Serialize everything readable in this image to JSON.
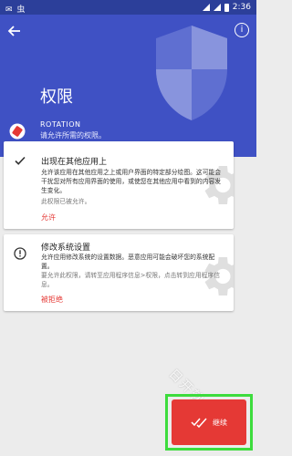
{
  "status_bar": {
    "left": "✉  虫",
    "time": "2:36"
  },
  "header": {
    "title": "权限",
    "app_name": "ROTATION",
    "app_subtitle": "请允许所需的权限。",
    "colors": {
      "bar": "#3f51c4",
      "status": "#2c3f9a"
    }
  },
  "cards": [
    {
      "title": "出现在其他应用上",
      "description": "允许该应用在其他应用之上或用户界面的特定部分绘图。这可能会干扰您对所有应用界面的使用，或使您在其他应用中看到的内容发生变化。",
      "note": "此权限已被允许。",
      "action": "允许",
      "icon": "check-icon"
    },
    {
      "title": "修改系统设置",
      "description": "允许应用修改系统的设置数据。恶意应用可能会破坏您的系统配置。",
      "note": "要允许此权限，请转至应用程序信息>权限，点击转到应用程序信息。",
      "action": "被拒绝",
      "icon": "alert-icon"
    }
  ],
  "fab": {
    "label": "继续",
    "icon": "double-check-icon",
    "color": "#e53935"
  },
  "watermark": "日开软件"
}
